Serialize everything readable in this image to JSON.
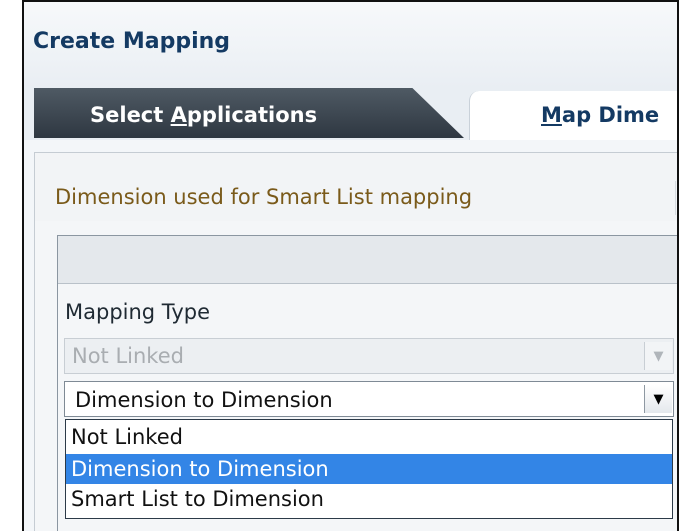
{
  "window": {
    "title": "Create Mapping"
  },
  "tabs": [
    {
      "label_prefix": "Select ",
      "label_accel": "A",
      "label_suffix": "pplications",
      "active": true
    },
    {
      "label_prefix": "",
      "label_accel": "M",
      "label_suffix": "ap Dime",
      "active": false
    }
  ],
  "section": {
    "title": "Dimension used for Smart List mapping"
  },
  "mapping_type": {
    "label": "Mapping Type",
    "disabled_value": "Not Linked",
    "selected_value": "Dimension to Dimension",
    "options": [
      {
        "label": "Not Linked",
        "selected": false
      },
      {
        "label": "Dimension to Dimension",
        "selected": true
      },
      {
        "label": "Smart List to Dimension",
        "selected": false
      }
    ]
  },
  "icons": {
    "dropdown_disabled": "chevron-down-icon",
    "dropdown": "chevron-down-icon"
  },
  "colors": {
    "title": "#143a63",
    "section_title": "#7a5a1a",
    "selected_option_bg": "#3385e6"
  }
}
